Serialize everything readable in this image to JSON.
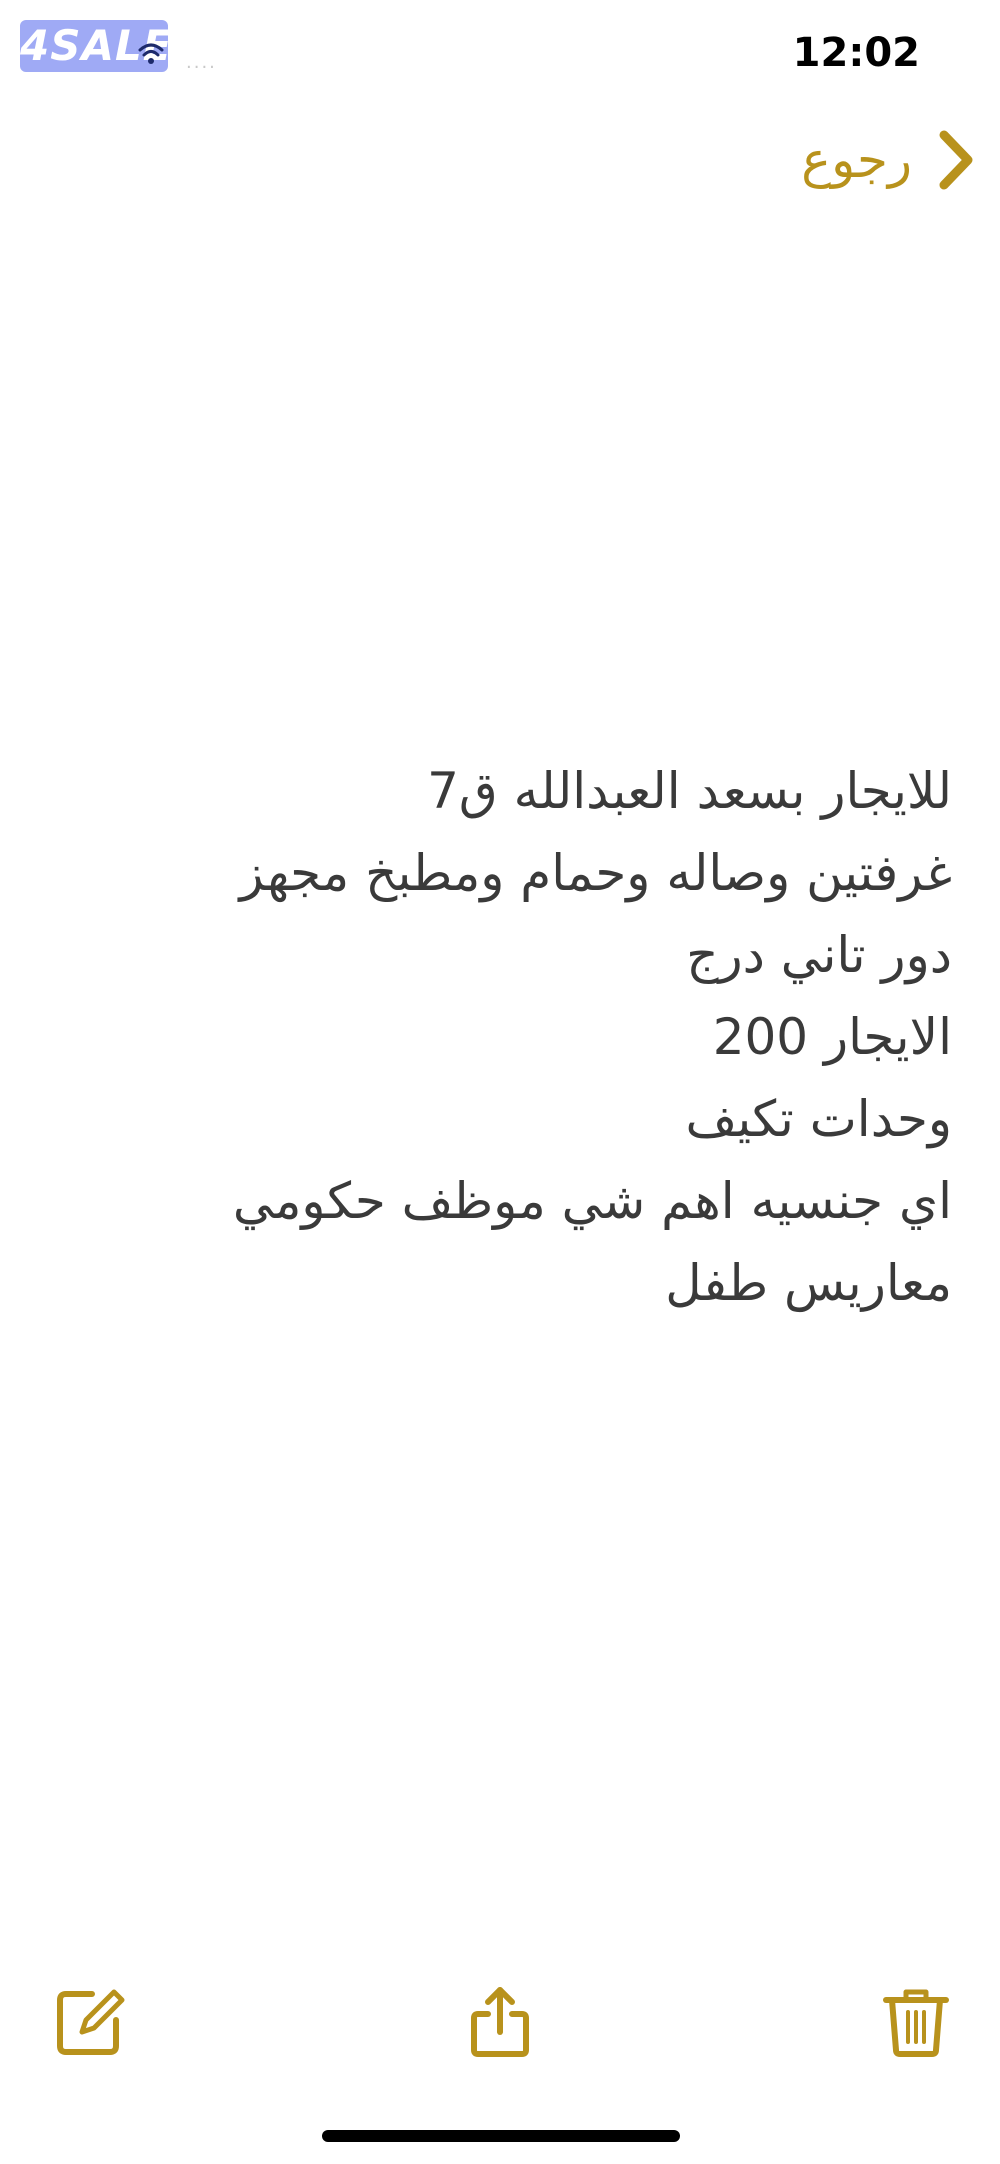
{
  "status_bar": {
    "logo_text": "4SALE",
    "signal_dots": "....",
    "time": "12:02"
  },
  "nav": {
    "back_label": "رجوع",
    "back_icon": "chevron-right-icon"
  },
  "note": {
    "lines": [
      "للايجار بسعد العبدالله ق7",
      "غرفتين وصاله وحمام ومطبخ مجهز",
      "دور تاني درج",
      "الايجار 200",
      "وحدات تكيف",
      "اي جنسيه اهم شي موظف حكومي",
      "معاريس طفل"
    ]
  },
  "toolbar": {
    "compose_icon": "compose-icon",
    "share_icon": "share-icon",
    "trash_icon": "trash-icon"
  },
  "colors": {
    "accent": "#b8921c",
    "text": "#3a3a3a",
    "background": "#ffffff"
  }
}
